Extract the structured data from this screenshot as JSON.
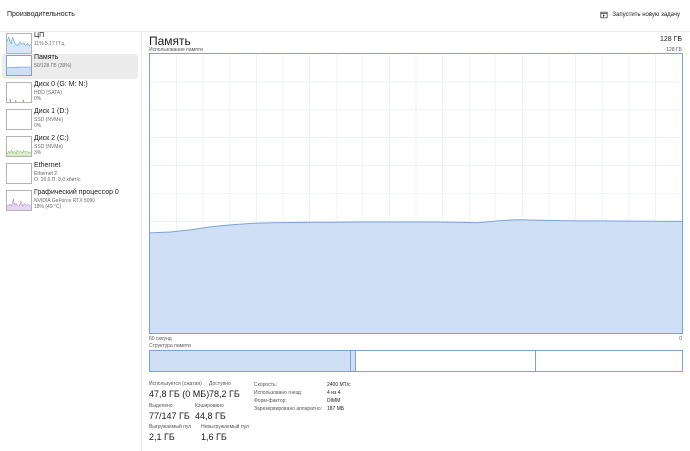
{
  "header": {
    "title": "Производительность",
    "new_task_label": "Запустить новую задачу",
    "new_task_icon": "run-task-icon"
  },
  "sidebar": {
    "items": [
      {
        "name": "ЦП",
        "sub1": "11%  5,17 ГГц",
        "sub2": "",
        "color": "#1f78c8",
        "selected": false
      },
      {
        "name": "Память",
        "sub1": "50/128 ГБ (39%)",
        "sub2": "",
        "color": "#6b9ad6",
        "selected": true
      },
      {
        "name": "Диск 0 (G: M: N:)",
        "sub1": "HDD (SATA)",
        "sub2": "0%",
        "color": "#4c9a2a",
        "selected": false
      },
      {
        "name": "Диск 1 (D:)",
        "sub1": "SSD (NVMe)",
        "sub2": "0%",
        "color": "#4c9a2a",
        "selected": false
      },
      {
        "name": "Диск 2 (C:)",
        "sub1": "SSD (NVMe)",
        "sub2": "3%",
        "color": "#4c9a2a",
        "selected": false
      },
      {
        "name": "Ethernet",
        "sub1": "Ethernet 2",
        "sub2": "О: 16,0  П: 8,0 кбит/с",
        "color": "#a07ab8",
        "selected": false
      },
      {
        "name": "Графический процессор 0",
        "sub1": "NVIDIA GeForce RTX 5090",
        "sub2": "18% (49 °C)",
        "color": "#8a4fc0",
        "selected": false
      }
    ]
  },
  "main": {
    "title": "Память",
    "capacity": "128 ГБ",
    "usage_label": "Использование памяти",
    "usage_max": "128 ГБ",
    "time_label": "60 секунд",
    "time_zero": "0",
    "structure_label": "Структура памяти",
    "accent_color": "#7aa3d8",
    "fill_color": "#cfe0f6"
  },
  "usage_history_pct": [
    35.9,
    36.2,
    37.0,
    38.1,
    38.8,
    39.3,
    39.5,
    39.6,
    39.7,
    39.7,
    39.8,
    39.8,
    39.8,
    39.8,
    39.8,
    39.7,
    39.5,
    40.2,
    40.6,
    40.4,
    40.3,
    40.2,
    40.2,
    40.1,
    40.1,
    40.0,
    40.0
  ],
  "structure_pct": {
    "used": 37.5,
    "modified": 1.1,
    "standby": 33.7,
    "free": 27.7
  },
  "stats": {
    "in_use_label": "Используется (сжатая)",
    "in_use_value": "47,8 ГБ (0 МБ)",
    "available_label": "Доступно",
    "available_value": "78,2 ГБ",
    "committed_label": "Выделено",
    "committed_value": "77/147 ГБ",
    "cached_label": "Кэшировано",
    "cached_value": "44,8 ГБ",
    "paged_label": "Выгружаемый пул",
    "paged_value": "2,1 ГБ",
    "nonpaged_label": "Невыгружаемый пул",
    "nonpaged_value": "1,6 ГБ"
  },
  "details": {
    "speed_label": "Скорость:",
    "speed_value": "2400 МТ/с",
    "slots_label": "Использовано гнезд:",
    "slots_value": "4 из 4",
    "form_label": "Форм-фактор:",
    "form_value": "DIMM",
    "reserved_label": "Зарезервировано аппаратно:",
    "reserved_value": "187 МБ"
  }
}
